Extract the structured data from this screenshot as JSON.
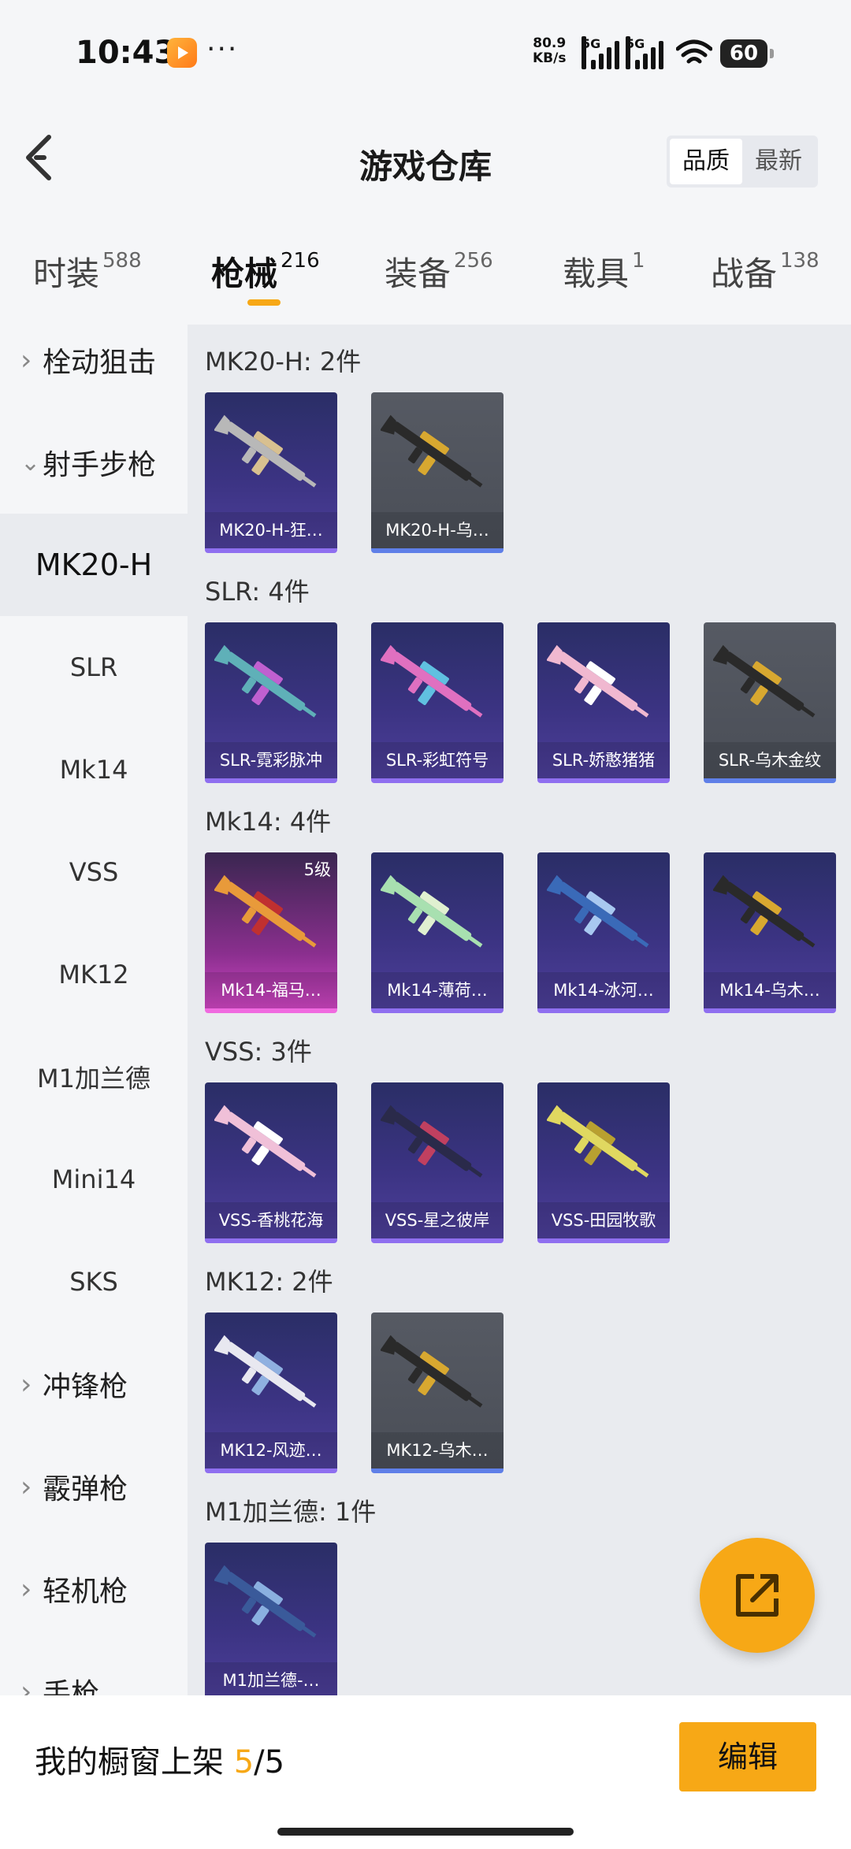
{
  "status_bar": {
    "time": "10:43",
    "dots": "···",
    "net_speed_value": "80.9",
    "net_speed_unit": "KB/s",
    "sim1": "5G",
    "sim2": "5G",
    "battery": "60"
  },
  "header": {
    "title": "游戏仓库",
    "sort_options": [
      "品质",
      "最新"
    ],
    "sort_selected": "品质"
  },
  "tabs": [
    {
      "label": "时装",
      "count": "588"
    },
    {
      "label": "枪械",
      "count": "216"
    },
    {
      "label": "装备",
      "count": "256"
    },
    {
      "label": "载具",
      "count": "1"
    },
    {
      "label": "战备",
      "count": "138"
    }
  ],
  "active_tab": "枪械",
  "sidebar": {
    "items": [
      {
        "label": "栓动狙击",
        "type": "category",
        "expanded": false
      },
      {
        "label": "射手步枪",
        "type": "category",
        "expanded": true
      },
      {
        "label": "MK20-H",
        "type": "sub",
        "active": true
      },
      {
        "label": "SLR",
        "type": "sub"
      },
      {
        "label": "Mk14",
        "type": "sub"
      },
      {
        "label": "VSS",
        "type": "sub"
      },
      {
        "label": "MK12",
        "type": "sub"
      },
      {
        "label": "M1加兰德",
        "type": "sub"
      },
      {
        "label": "Mini14",
        "type": "sub"
      },
      {
        "label": "SKS",
        "type": "sub"
      },
      {
        "label": "冲锋枪",
        "type": "category",
        "expanded": false
      },
      {
        "label": "霰弹枪",
        "type": "category",
        "expanded": false
      },
      {
        "label": "轻机枪",
        "type": "category",
        "expanded": false
      },
      {
        "label": "手枪",
        "type": "category",
        "expanded": false
      }
    ]
  },
  "groups": [
    {
      "title": "MK20-H: 2件",
      "items": [
        {
          "name": "MK20-H-狂…",
          "style": "purple",
          "color": "#b8b8b8",
          "accent": "#d8c090"
        },
        {
          "name": "MK20-H-乌…",
          "style": "gray",
          "color": "#2a2a2a",
          "accent": "#d8a830"
        }
      ]
    },
    {
      "title": "SLR: 4件",
      "items": [
        {
          "name": "SLR-霓彩脉冲",
          "style": "purple",
          "color": "#5fb0b8",
          "accent": "#c060d0"
        },
        {
          "name": "SLR-彩虹符号",
          "style": "purple",
          "color": "#e070c0",
          "accent": "#60c0e0"
        },
        {
          "name": "SLR-娇憨猪猪",
          "style": "purple",
          "color": "#f0b8d0",
          "accent": "#ffffff"
        },
        {
          "name": "SLR-乌木金纹",
          "style": "gray",
          "color": "#2a2a2a",
          "accent": "#d8a830"
        }
      ]
    },
    {
      "title": "Mk14: 4件",
      "items": [
        {
          "name": "Mk14-福马…",
          "style": "pink",
          "color": "#e89a3a",
          "accent": "#c03030",
          "level": "5级"
        },
        {
          "name": "Mk14-薄荷…",
          "style": "purple",
          "color": "#a8e0b0",
          "accent": "#e0f0d0"
        },
        {
          "name": "Mk14-冰河…",
          "style": "purple",
          "color": "#3a6ab8",
          "accent": "#a8c8f0"
        },
        {
          "name": "Mk14-乌木…",
          "style": "purple",
          "color": "#2a2a2a",
          "accent": "#d8a830"
        }
      ]
    },
    {
      "title": "VSS: 3件",
      "items": [
        {
          "name": "VSS-香桃花海",
          "style": "purple",
          "color": "#f0c0d8",
          "accent": "#ffffff"
        },
        {
          "name": "VSS-星之彼岸",
          "style": "purple",
          "color": "#2a2a4a",
          "accent": "#c04060"
        },
        {
          "name": "VSS-田园牧歌",
          "style": "purple",
          "color": "#e0d860",
          "accent": "#b8a030"
        }
      ]
    },
    {
      "title": "MK12: 2件",
      "items": [
        {
          "name": "MK12-风迹…",
          "style": "purple",
          "color": "#e8e8f0",
          "accent": "#8fb0e0"
        },
        {
          "name": "MK12-乌木…",
          "style": "gray",
          "color": "#2a2a2a",
          "accent": "#d8a830"
        }
      ]
    },
    {
      "title": "M1加兰德: 1件",
      "items": [
        {
          "name": "M1加兰德-…",
          "style": "purple",
          "color": "#3a5a9a",
          "accent": "#8ab0e0"
        }
      ]
    }
  ],
  "bottom_bar": {
    "label": "我的橱窗上架",
    "count_current": "5",
    "count_total": "/5",
    "edit_label": "编辑"
  },
  "icons": {
    "back": "chevron-left-icon",
    "fab": "share-external-icon"
  },
  "colors": {
    "accent": "#f7a816"
  }
}
